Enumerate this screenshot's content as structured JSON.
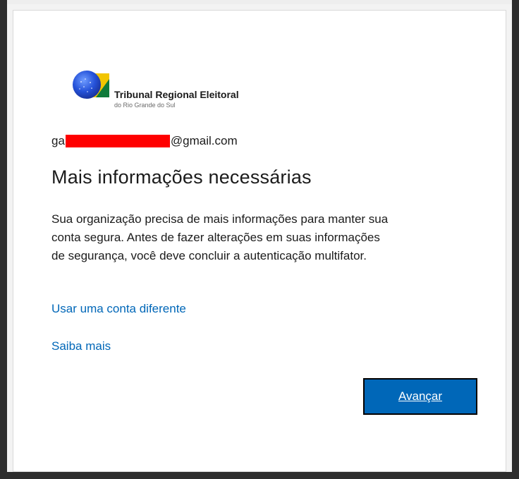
{
  "org": {
    "logo_title": "Tribunal Regional Eleitoral",
    "logo_subtitle": "do Rio Grande do Sul"
  },
  "account": {
    "email_prefix": "ga",
    "email_suffix": "@gmail.com"
  },
  "content": {
    "heading": "Mais informações necessárias",
    "description_lines": [
      "Sua organização precisa de mais informações para manter sua",
      "conta segura. Antes de fazer alterações em suas informações",
      "de segurança, você deve concluir a autenticação multifator."
    ]
  },
  "links": {
    "use_other_account": "Usar uma conta diferente",
    "learn_more": "Saiba mais"
  },
  "actions": {
    "next_label": "Avançar"
  },
  "colors": {
    "accent": "#0067b8",
    "redaction": "#ff0000",
    "logo_blue": "#1f4fd6",
    "logo_yellow": "#f2c500",
    "logo_green": "#0f7a3a"
  }
}
